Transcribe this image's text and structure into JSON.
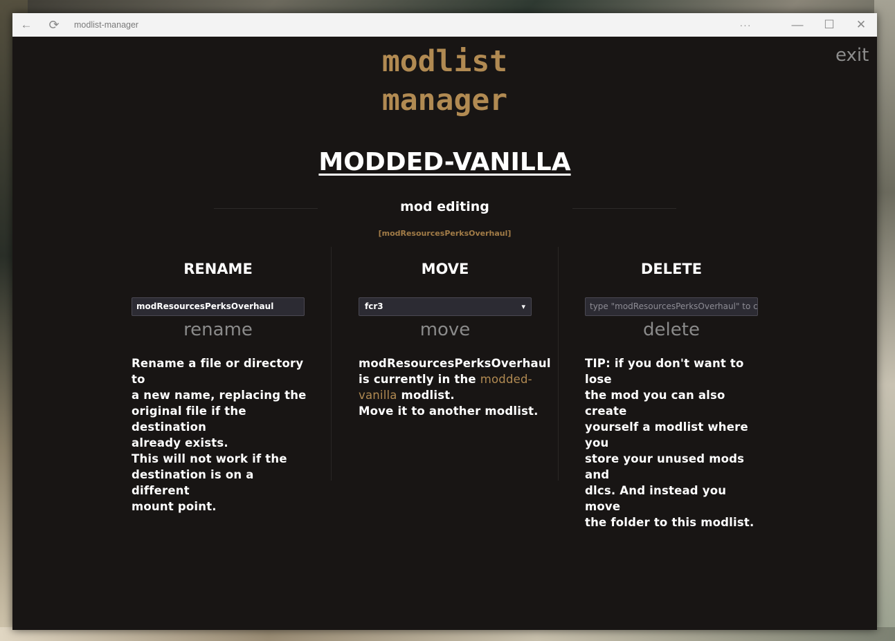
{
  "window": {
    "title": "modlist-manager",
    "more_glyph": "···",
    "min_glyph": "—",
    "max_glyph": "☐",
    "close_glyph": "✕",
    "back_glyph": "←",
    "refresh_glyph": "⟳"
  },
  "app": {
    "title_line1": "modlist",
    "title_line2": "manager",
    "exit_label": "exit",
    "modlist_name": "MODDED-VANILLA",
    "section_title": "mod editing",
    "mod_tag": "[modResourcesPerksOverhaul]"
  },
  "rename": {
    "heading": "RENAME",
    "input_value": "modResourcesPerksOverhaul",
    "action_label": "rename",
    "description_lines": [
      "Rename a file or directory to",
      "a new name, replacing the",
      "original file if the destination",
      "already exists.",
      "This will not work if the",
      "destination is on a different",
      "mount point."
    ]
  },
  "move": {
    "heading": "MOVE",
    "selected_option": "fcr3",
    "action_label": "move",
    "desc_mod": "modResourcesPerksOverhaul",
    "desc_pre": "is currently in the ",
    "desc_accent1": "modded-",
    "desc_accent2": "vanilla",
    "desc_post": " modlist.",
    "desc_last": "Move it to another modlist."
  },
  "delete": {
    "heading": "DELETE",
    "input_placeholder": "type \"modResourcesPerksOverhaul\" to c",
    "action_label": "delete",
    "description_lines": [
      "TIP: if you don't want to lose",
      "the mod you can also create",
      "yourself a modlist where you",
      "store your unused mods and",
      "dlcs. And instead you move",
      "the folder to this modlist."
    ]
  },
  "colors": {
    "accent": "#b18a52",
    "background": "#181514",
    "text": "#ffffff",
    "muted": "#8a8a8a"
  }
}
